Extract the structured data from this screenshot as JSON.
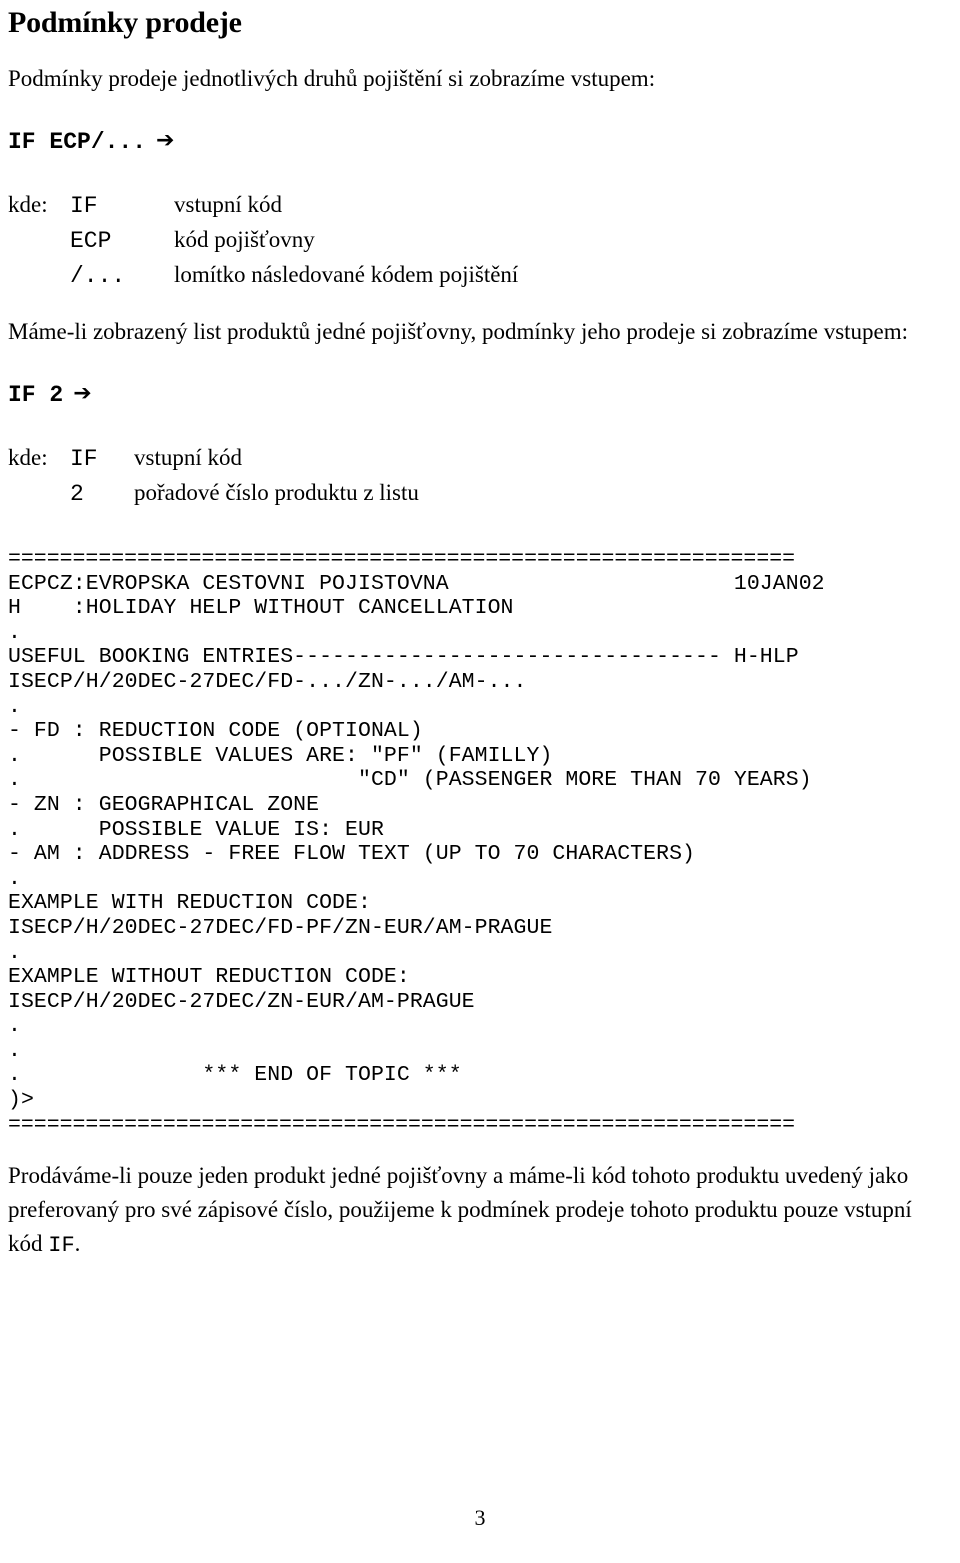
{
  "document": {
    "title": "Podmínky prodeje",
    "page_number": "3"
  },
  "intro": {
    "paragraph": "Podmínky prodeje jednotlivých druhů pojištění si zobrazíme vstupem:"
  },
  "command_1": {
    "text": "IF ECP/...",
    "arrow": "➔"
  },
  "legend_1": {
    "kde_label": "kde:",
    "rows": [
      {
        "code": "IF",
        "desc": "vstupní kód"
      },
      {
        "code": "ECP",
        "desc": "kód pojišťovny"
      },
      {
        "code": "/...",
        "desc": "lomítko následované kódem pojištění"
      }
    ]
  },
  "second_intro": {
    "paragraph": "Máme-li zobrazený list produktů jedné pojišťovny, podmínky jeho prodeje si zobrazíme vstupem:"
  },
  "command_2": {
    "text": "IF 2",
    "arrow": "➔"
  },
  "legend_2": {
    "kde_label": "kde:",
    "rows": [
      {
        "code": "IF",
        "desc": "vstupní kód"
      },
      {
        "code": "2",
        "desc": "pořadové číslo produktu z listu"
      }
    ]
  },
  "terminal": {
    "rule_top": "=============================================================",
    "rule_bottom": "=============================================================",
    "lines": [
      "ECPCZ:EVROPSKA CESTOVNI POJISTOVNA                      10JAN02",
      "H    :HOLIDAY HELP WITHOUT CANCELLATION",
      ".",
      "USEFUL BOOKING ENTRIES--------------------------------- H-HLP",
      "ISECP/H/20DEC-27DEC/FD-.../ZN-.../AM-...",
      ".",
      "- FD : REDUCTION CODE (OPTIONAL)",
      ".      POSSIBLE VALUES ARE: \"PF\" (FAMILLY)",
      ".                          \"CD\" (PASSENGER MORE THAN 70 YEARS)",
      "- ZN : GEOGRAPHICAL ZONE",
      ".      POSSIBLE VALUE IS: EUR",
      "- AM : ADDRESS - FREE FLOW TEXT (UP TO 70 CHARACTERS)",
      ".",
      "EXAMPLE WITH REDUCTION CODE:",
      "ISECP/H/20DEC-27DEC/FD-PF/ZN-EUR/AM-PRAGUE",
      ".",
      "EXAMPLE WITHOUT REDUCTION CODE:",
      "ISECP/H/20DEC-27DEC/ZN-EUR/AM-PRAGUE",
      ".",
      ".",
      ".              *** END OF TOPIC ***",
      ")>"
    ]
  },
  "closing": {
    "text_before_code": "Prodáváme-li pouze jeden produkt jedné pojišťovny a máme-li kód tohoto produktu uvedený jako preferovaný pro své zápisové číslo, použijeme k podmínek prodeje tohoto produktu pouze vstupní kód ",
    "code": "IF",
    "text_after_code": "."
  }
}
